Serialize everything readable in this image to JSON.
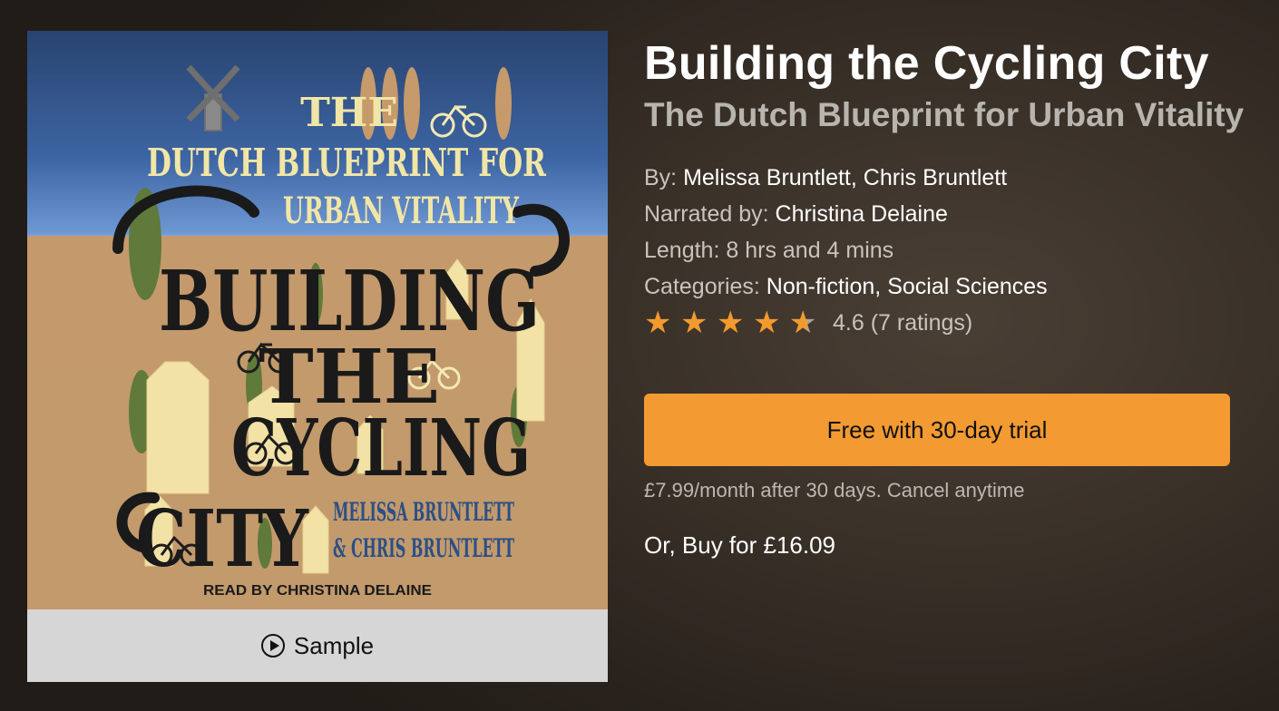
{
  "book": {
    "title": "Building the Cycling City",
    "subtitle": "The Dutch Blueprint for Urban Vitality",
    "by_label": "By:",
    "authors": [
      "Melissa Bruntlett",
      "Chris Bruntlett"
    ],
    "narrated_label": "Narrated by:",
    "narrator": "Christina Delaine",
    "length_label": "Length:",
    "length": "8 hrs and 4 mins",
    "categories_label": "Categories:",
    "categories": [
      "Non-fiction",
      "Social Sciences"
    ],
    "rating_value": 4.6,
    "rating_text": "4.6 (7 ratings)",
    "stars": 5
  },
  "cover": {
    "line1": "THE",
    "line2": "DUTCH BLUEPRINT FOR",
    "line3": "URBAN VITALITY",
    "title1": "BUILDING",
    "title2": "THE",
    "title3": "CYCLING",
    "title4": "CITY",
    "author1": "MELISSA BRUNTLETT",
    "author2": "& CHRIS BRUNTLETT",
    "narrator_line": "READ BY CHRISTINA DELAINE"
  },
  "sample": {
    "label": "Sample",
    "icon": "play-circle-icon"
  },
  "purchase": {
    "cta_label": "Free with 30-day trial",
    "fine_print": "£7.99/month after 30 days. Cancel anytime",
    "buy_label": "Or, Buy for £16.09"
  },
  "colors": {
    "accent": "#f39a32",
    "star": "#f29a2e"
  }
}
